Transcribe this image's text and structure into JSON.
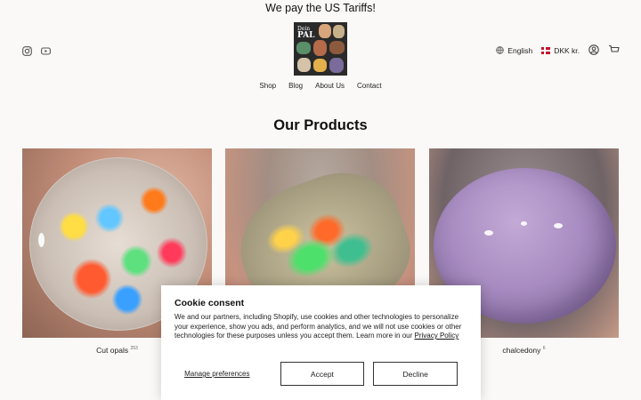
{
  "announcement": "We pay the US Tariffs!",
  "header": {
    "logo": {
      "line1": "Dein",
      "line2": "PAL"
    },
    "language": "English",
    "currency": "DKK kr."
  },
  "nav": [
    "Shop",
    "Blog",
    "About Us",
    "Contact"
  ],
  "section_title": "Our Products",
  "products": [
    {
      "label": "Cut opals",
      "count": "253"
    },
    {
      "label": "",
      "count": ""
    },
    {
      "label": "chalcedony",
      "count": "6"
    }
  ],
  "cookie": {
    "title": "Cookie consent",
    "body": "We and our partners, including Shopify, use cookies and other technologies to personalize your experience, show you ads, and perform analytics, and we will not use cookies or other technologies for these purposes unless you accept them. Learn more in our",
    "link": "Privacy Policy",
    "manage": "Manage preferences",
    "accept": "Accept",
    "decline": "Decline"
  },
  "colors": {
    "background": "#faf9f7",
    "danish_flag": "#c8102e"
  }
}
